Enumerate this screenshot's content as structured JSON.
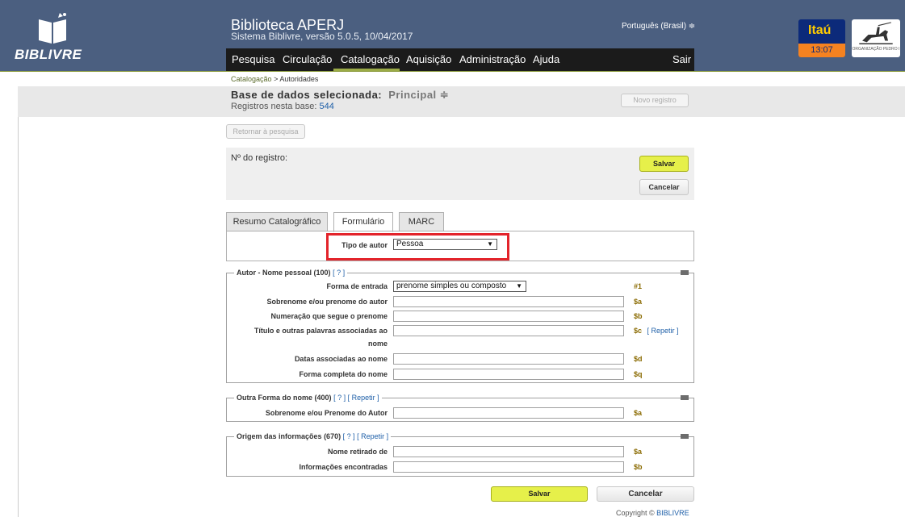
{
  "app": {
    "logo_text": "BIBLIVRE",
    "title": "Biblioteca APERJ",
    "subtitle": "Sistema Biblivre, versão 5.0.5, 10/04/2017",
    "language": "Português (Brasil) ≑"
  },
  "nav": {
    "items": [
      "Pesquisa",
      "Circulação",
      "Catalogação",
      "Aquisição",
      "Administração",
      "Ajuda"
    ],
    "logout": "Sair",
    "active": "Catalogação"
  },
  "bank": {
    "brand": "Itaú",
    "time": "13:07"
  },
  "org": {
    "caption": "ORGANIZAÇÃO PEDRO I"
  },
  "breadcrumb": {
    "section": "Catalogação",
    "separator": ">",
    "page": "Autoridades"
  },
  "database": {
    "label": "Base de dados selecionada:",
    "value": "Principal ≑",
    "count_label": "Registros nesta base:",
    "count": "544"
  },
  "buttons": {
    "new_record": "Novo registro",
    "back": "Retornar à pesquisa",
    "save": "Salvar",
    "cancel": "Cancelar"
  },
  "record": {
    "number_label": "Nº do registro:"
  },
  "tabs": [
    "Resumo Catalográfico",
    "Formulário",
    "MARC"
  ],
  "active_tab": "Formulário",
  "author_type": {
    "label": "Tipo de autor",
    "value": "Pessoa"
  },
  "sections": {
    "personal_name": {
      "title": "Autor - Nome pessoal",
      "code": "(100)",
      "help": "[ ? ]",
      "entry_form": {
        "label": "Forma de entrada",
        "value": "prenome simples ou composto",
        "code": "#1"
      },
      "fields": [
        {
          "label": "Sobrenome e/ou prenome do autor",
          "code": "$a"
        },
        {
          "label": "Numeração que segue o prenome",
          "code": "$b"
        },
        {
          "label": "Título e outras palavras associadas ao",
          "label2": "nome",
          "code": "$c",
          "repeat": "[ Repetir ]"
        },
        {
          "label": "Datas associadas ao nome",
          "code": "$d"
        },
        {
          "label": "Forma completa do nome",
          "code": "$q"
        }
      ]
    },
    "other_form": {
      "title": "Outra Forma do nome",
      "code": "(400)",
      "help": "[ ? ]",
      "repeat": "[ Repetir ]",
      "fields": [
        {
          "label": "Sobrenome e/ou Prenome do Autor",
          "code": "$a"
        }
      ]
    },
    "origin": {
      "title": "Origem das informações",
      "code": "(670)",
      "help": "[ ? ]",
      "repeat": "[ Repetir ]",
      "fields": [
        {
          "label": "Nome retirado de",
          "code": "$a"
        },
        {
          "label": "Informações encontradas",
          "code": "$b"
        }
      ]
    }
  },
  "footer": {
    "text": "Copyright ©",
    "brand": "BIBLIVRE"
  },
  "colors": {
    "header": "#4b5f80",
    "nav": "#1b1b1b",
    "accent": "#9bab47",
    "highlight": "#e3242b",
    "save": "#e6f04a"
  }
}
